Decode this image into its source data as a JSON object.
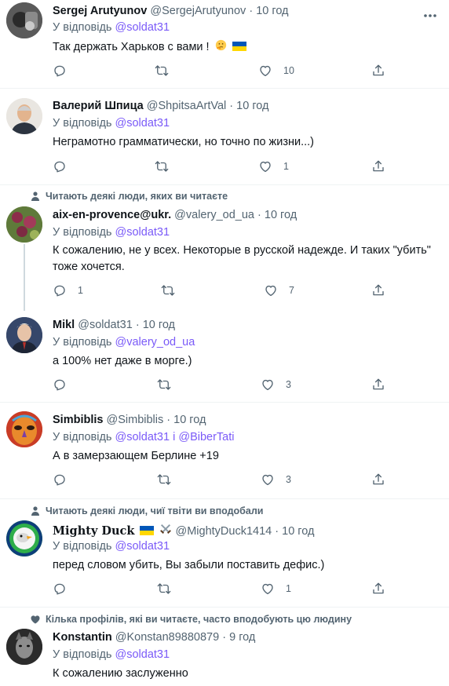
{
  "actions_icons": [
    "reply-icon",
    "retweet-icon",
    "like-icon",
    "share-icon"
  ],
  "tweets": [
    {
      "name": "Sergej Arutyunov",
      "handle": "@SergejArutyunov",
      "sep": "·",
      "time": "10 год",
      "reply_prefix": "У відповідь",
      "reply_to": "@soldat31",
      "text": "Так держать Харьков с вами !",
      "emoji": [
        "thinking-face-emoji",
        "ukraine-flag-emoji"
      ],
      "replies": "",
      "retweets": "",
      "likes": "10"
    },
    {
      "name": "Валерий Шпица",
      "handle": "@ShpitsaArtVal",
      "sep": "·",
      "time": "10 год",
      "reply_prefix": "У відповідь",
      "reply_to": "@soldat31",
      "text": "Неграмотно грамматически, но точно по жизни...)",
      "replies": "",
      "retweets": "",
      "likes": "1"
    },
    {
      "social_context": "Читають деякі люди, яких ви читаєте",
      "name": "aix-en-provence@ukr.",
      "handle": "@valery_od_ua",
      "sep": "·",
      "time": "10 год",
      "reply_prefix": "У відповідь",
      "reply_to": "@soldat31",
      "text": "К сожалению, не у всех. Некоторые  в русской надежде. И таких \"убить\" тоже хочется.",
      "replies": "1",
      "retweets": "",
      "likes": "7"
    },
    {
      "name": "Mikl",
      "handle": "@soldat31",
      "sep": "·",
      "time": "10 год",
      "reply_prefix": "У відповідь",
      "reply_to": "@valery_od_ua",
      "text": "а 100% нет даже в морге.)",
      "replies": "",
      "retweets": "",
      "likes": "3"
    },
    {
      "name": "Simbiblis",
      "handle": "@Simbiblis",
      "sep": "·",
      "time": "10 год",
      "reply_prefix": "У відповідь",
      "reply_to": "@soldat31",
      "reply_and": "і",
      "reply_to_2": "@BiberTati",
      "text": "А в замерзающем Берлине +19",
      "replies": "",
      "retweets": "",
      "likes": "3"
    },
    {
      "social_context": "Читають деякі люди, чиї твіти ви вподобали",
      "name": "Mighty Duck",
      "name_emoji": [
        "ukraine-flag-emoji",
        "crossed-swords-emoji"
      ],
      "handle": "@MightyDuck1414",
      "sep": "·",
      "time": "10 год",
      "reply_prefix": "У відповідь",
      "reply_to": "@soldat31",
      "text": "перед словом убить, Вы забыли поставить дефис.)",
      "replies": "",
      "retweets": "",
      "likes": "1"
    },
    {
      "social_context": "Кілька профілів, які ви читаєте, часто вподобують цю людину",
      "name": "Konstantin",
      "handle": "@Konstan89880879",
      "sep": "·",
      "time": "9 год",
      "reply_prefix": "У відповідь",
      "reply_to": "@soldat31",
      "text": "К сожалению заслуженно"
    }
  ]
}
